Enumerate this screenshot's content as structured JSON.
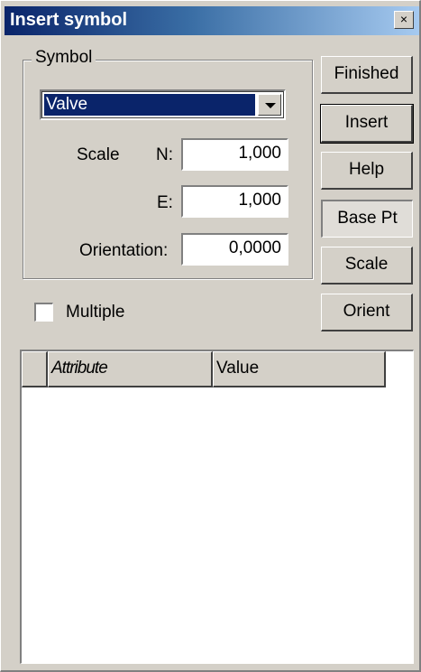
{
  "window": {
    "title": "Insert symbol",
    "close_glyph": "×"
  },
  "symbol_group": {
    "legend": "Symbol",
    "selected": "Valve",
    "scale_label": "Scale",
    "n_label": "N:",
    "n_value": "1,000",
    "e_label": "E:",
    "e_value": "1,000",
    "orientation_label": "Orientation:",
    "orientation_value": "0,0000"
  },
  "buttons": {
    "finished": "Finished",
    "insert": "Insert",
    "help": "Help",
    "base_pt": "Base Pt",
    "scale": "Scale",
    "orient": "Orient"
  },
  "multiple": {
    "label": "Multiple",
    "checked": false
  },
  "attribute_grid": {
    "columns": [
      "Attribute",
      "Value"
    ],
    "rows": []
  },
  "colors": {
    "dialog_face": "#d4d0c8",
    "title_active": "#0a246a",
    "selection": "#0a246a"
  }
}
